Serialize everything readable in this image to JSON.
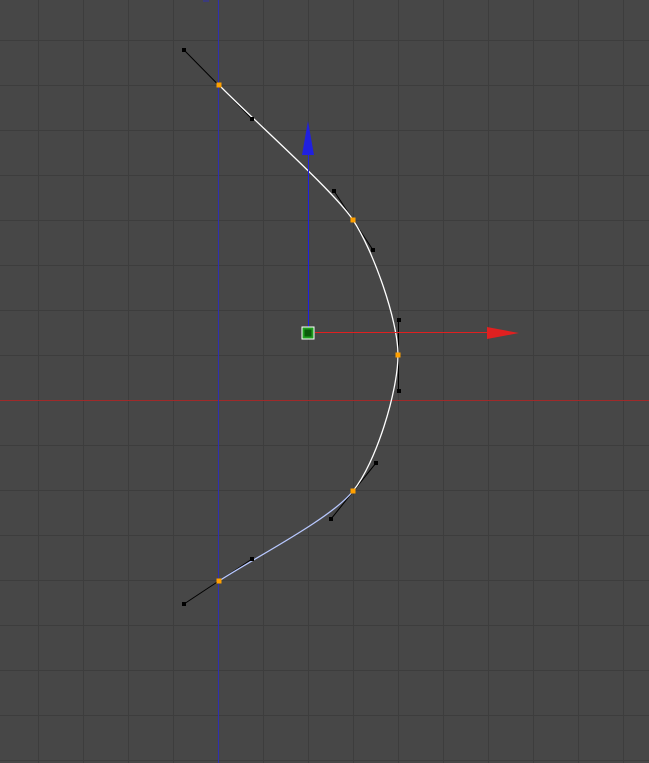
{
  "view": {
    "background": "#474747",
    "grid_color": "#3d3d3d",
    "x_axis_color": "#a02a2a",
    "z_axis_color": "#2f2fb0"
  },
  "curve": {
    "selected_color": "#ffffff",
    "unselected_color": "#b8c8ff",
    "knot_color": "#ffa000",
    "handle_color": "#000000"
  },
  "gizmo": {
    "x_arrow_color": "#e02020",
    "z_arrow_color": "#2020e0",
    "center_color": "#1e9e1e"
  },
  "icons": [
    "move-gizmo-x-arrow-icon",
    "move-gizmo-z-arrow-icon",
    "object-origin-icon"
  ]
}
